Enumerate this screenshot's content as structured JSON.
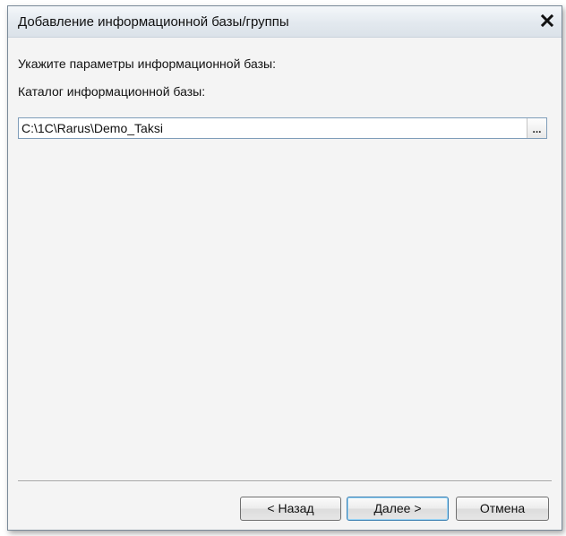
{
  "window": {
    "title": "Добавление информационной базы/группы",
    "close_icon": "close-icon"
  },
  "form": {
    "instruction": "Укажите параметры информационной базы:",
    "catalog_label": "Каталог информационной базы:",
    "catalog_value": "C:\\1C\\Rarus\\Demo_Taksi",
    "browse_label": "..."
  },
  "buttons": {
    "back": "< Назад",
    "next": "Далее >",
    "cancel": "Отмена"
  }
}
